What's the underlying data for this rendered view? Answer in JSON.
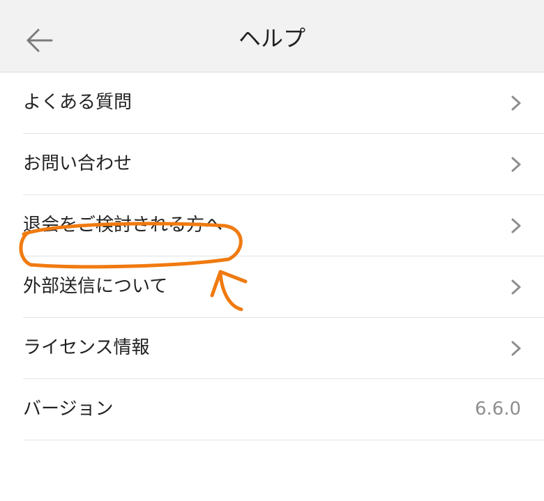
{
  "header": {
    "title": "ヘルプ",
    "back_icon": "arrow-left-icon"
  },
  "menu": {
    "items": [
      {
        "label": "よくある質問",
        "icon": "chevron-right-icon"
      },
      {
        "label": "お問い合わせ",
        "icon": "chevron-right-icon"
      },
      {
        "label": "退会をご検討される方へ",
        "icon": "chevron-right-icon"
      },
      {
        "label": "外部送信について",
        "icon": "chevron-right-icon"
      },
      {
        "label": "ライセンス情報",
        "icon": "chevron-right-icon"
      }
    ],
    "version": {
      "label": "バージョン",
      "value": "6.6.0"
    }
  },
  "colors": {
    "header_bg": "#f2f2f2",
    "text": "#222222",
    "chevron": "#8e8e8e",
    "annotation": "#f07a10"
  }
}
